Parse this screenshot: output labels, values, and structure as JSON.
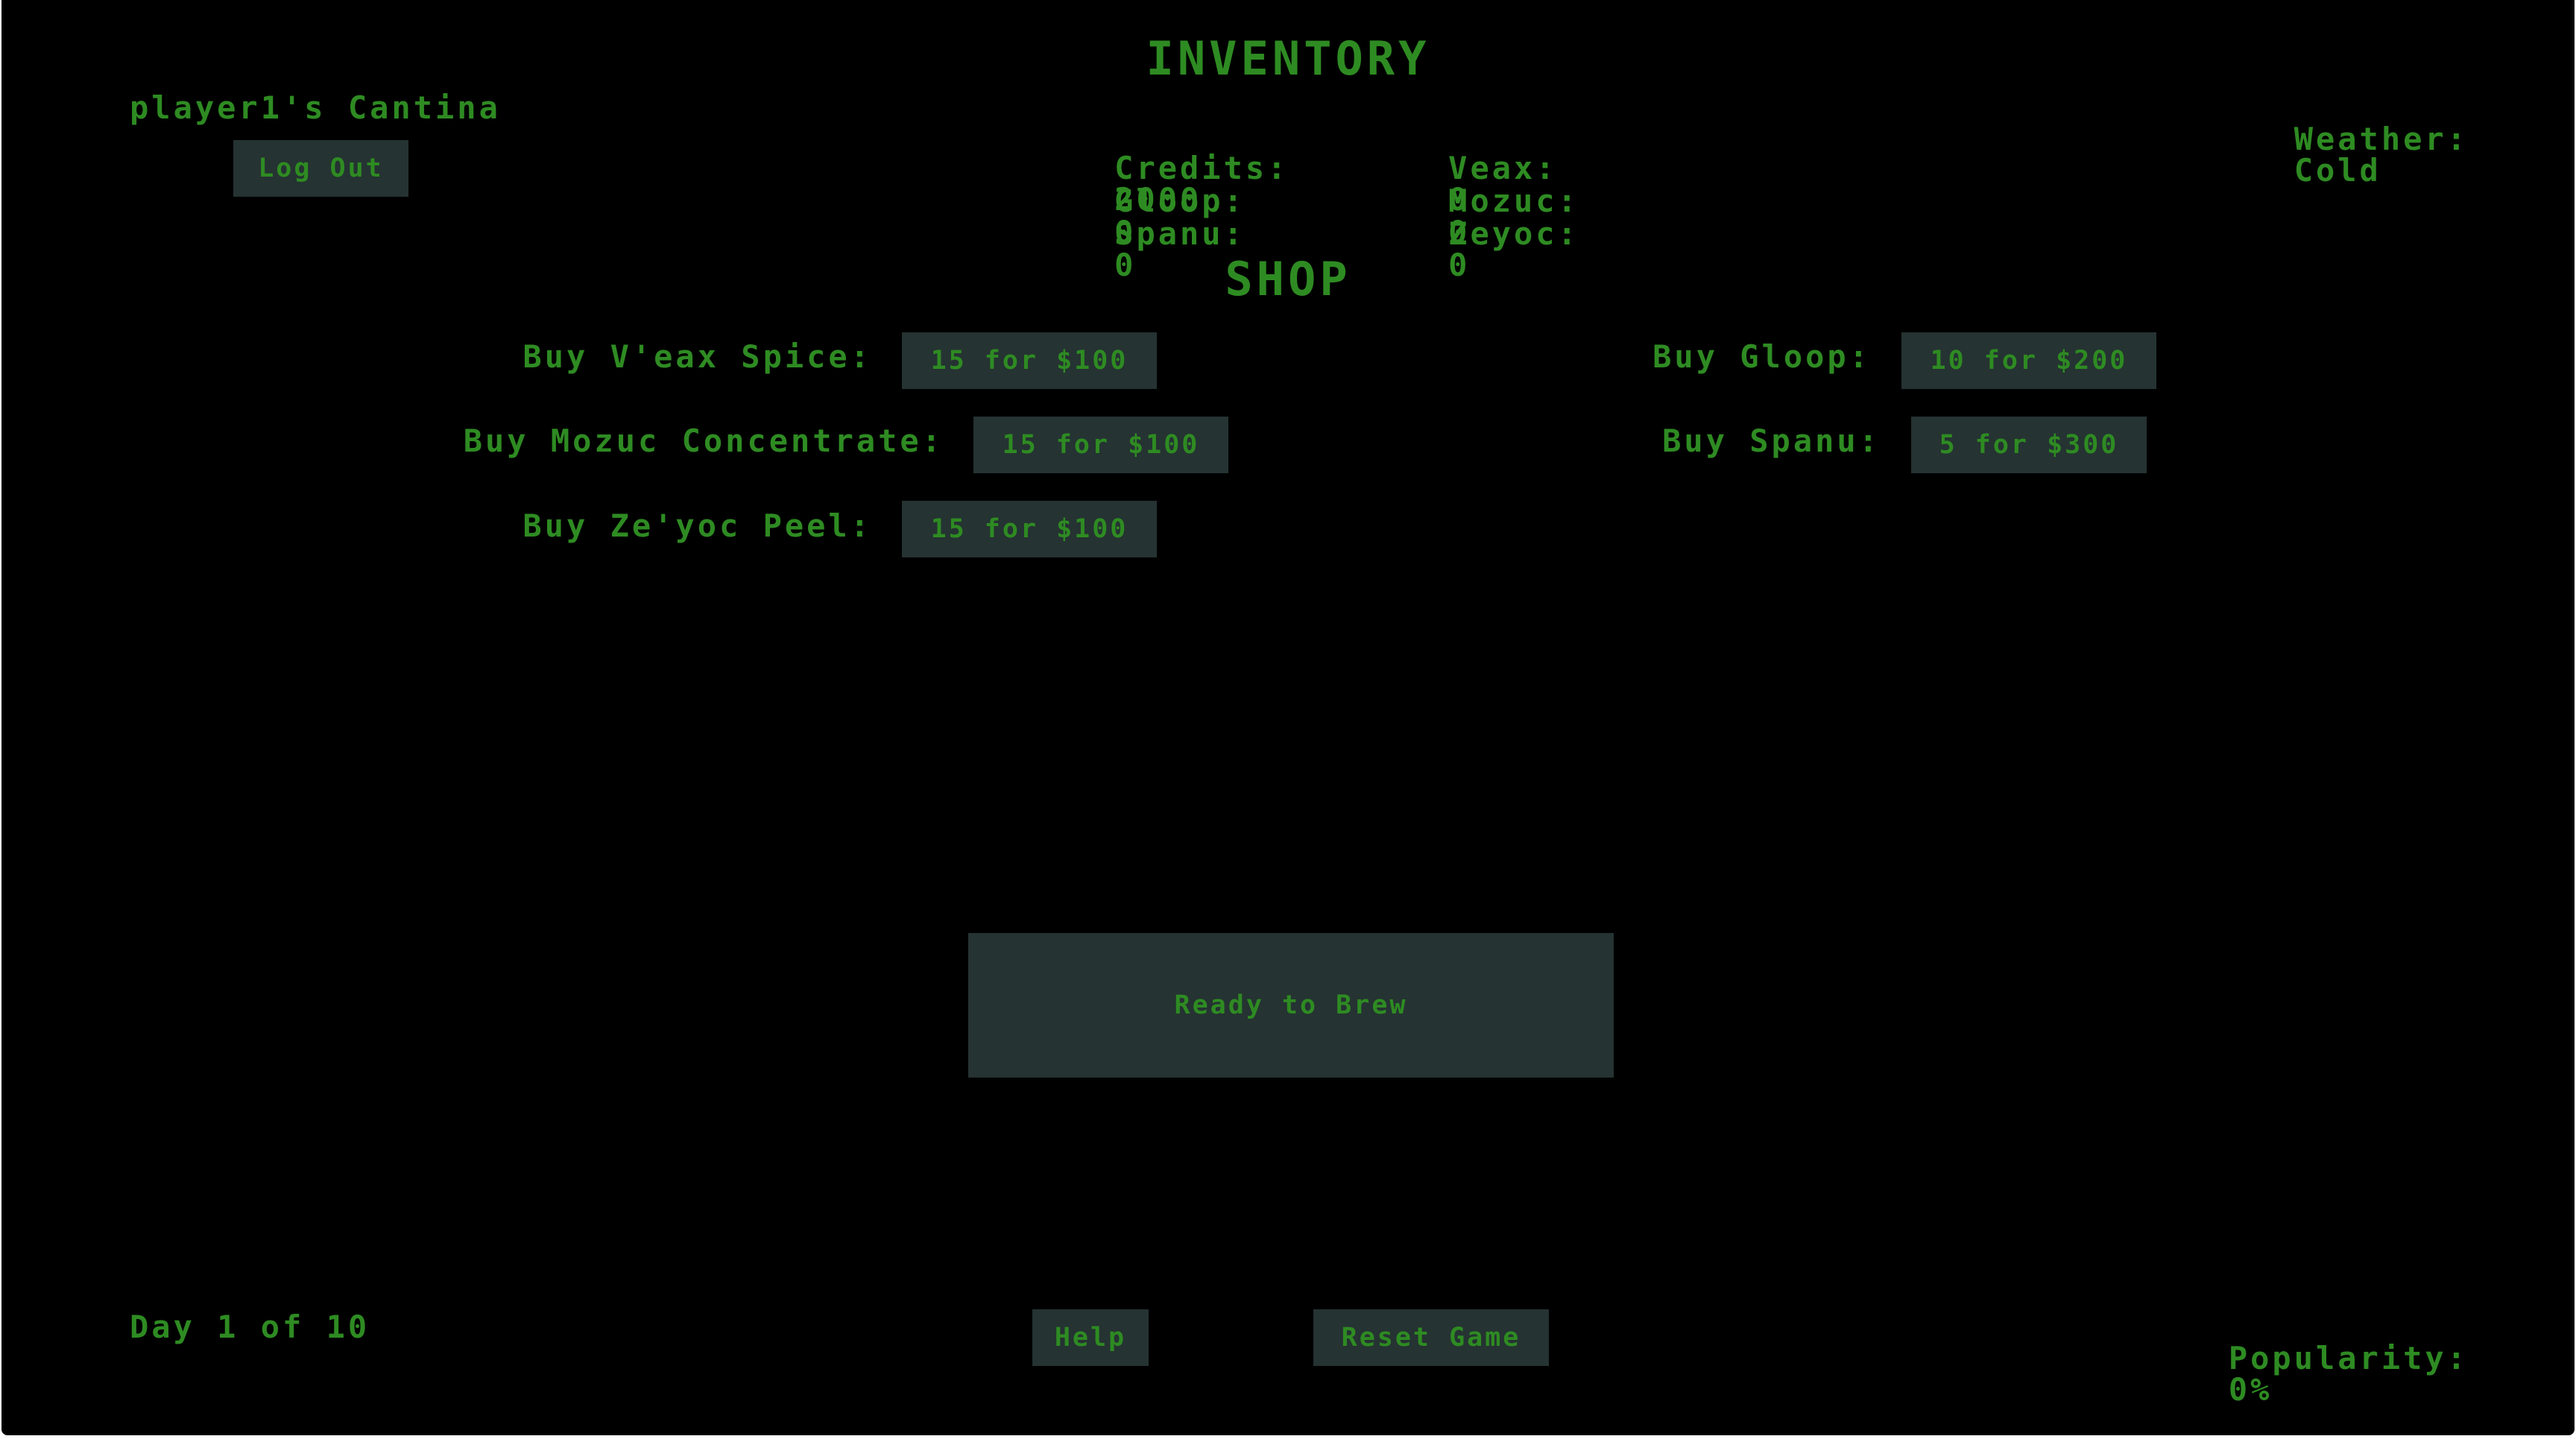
{
  "header": {
    "cantina_name": "player1's Cantina",
    "logout_label": "Log Out",
    "weather_label": "Weather:",
    "weather_value": "Cold"
  },
  "inventory": {
    "title": "INVENTORY",
    "credits_label": "Credits:",
    "credits_value": "2000",
    "veax_label": "Veax:",
    "veax_value": "0",
    "gloop_label": "Gloop:",
    "gloop_value": "0",
    "mozuc_label": "Mozuc:",
    "mozuc_value": "0",
    "spanu_label": "Spanu:",
    "spanu_value": "0",
    "zeyoc_label": "Zeyoc:",
    "zeyoc_value": "0"
  },
  "shop": {
    "title": "SHOP",
    "items": [
      {
        "label": "Buy V'eax Spice:",
        "offer": "15 for $100"
      },
      {
        "label": "Buy Mozuc Concentrate:",
        "offer": "15 for $100"
      },
      {
        "label": "Buy Ze'yoc Peel:",
        "offer": "15 for $100"
      },
      {
        "label": "Buy Gloop:",
        "offer": "10 for $200"
      },
      {
        "label": "Buy Spanu:",
        "offer": "5 for $300"
      }
    ]
  },
  "brew": {
    "label": "Ready to Brew"
  },
  "footer": {
    "day_text": "Day 1 of 10",
    "help_label": "Help",
    "reset_label": "Reset Game",
    "popularity_label": "Popularity:",
    "popularity_value": "0%"
  },
  "colors": {
    "background": "#000000",
    "text": "#2e8b22",
    "button": "#253332"
  }
}
